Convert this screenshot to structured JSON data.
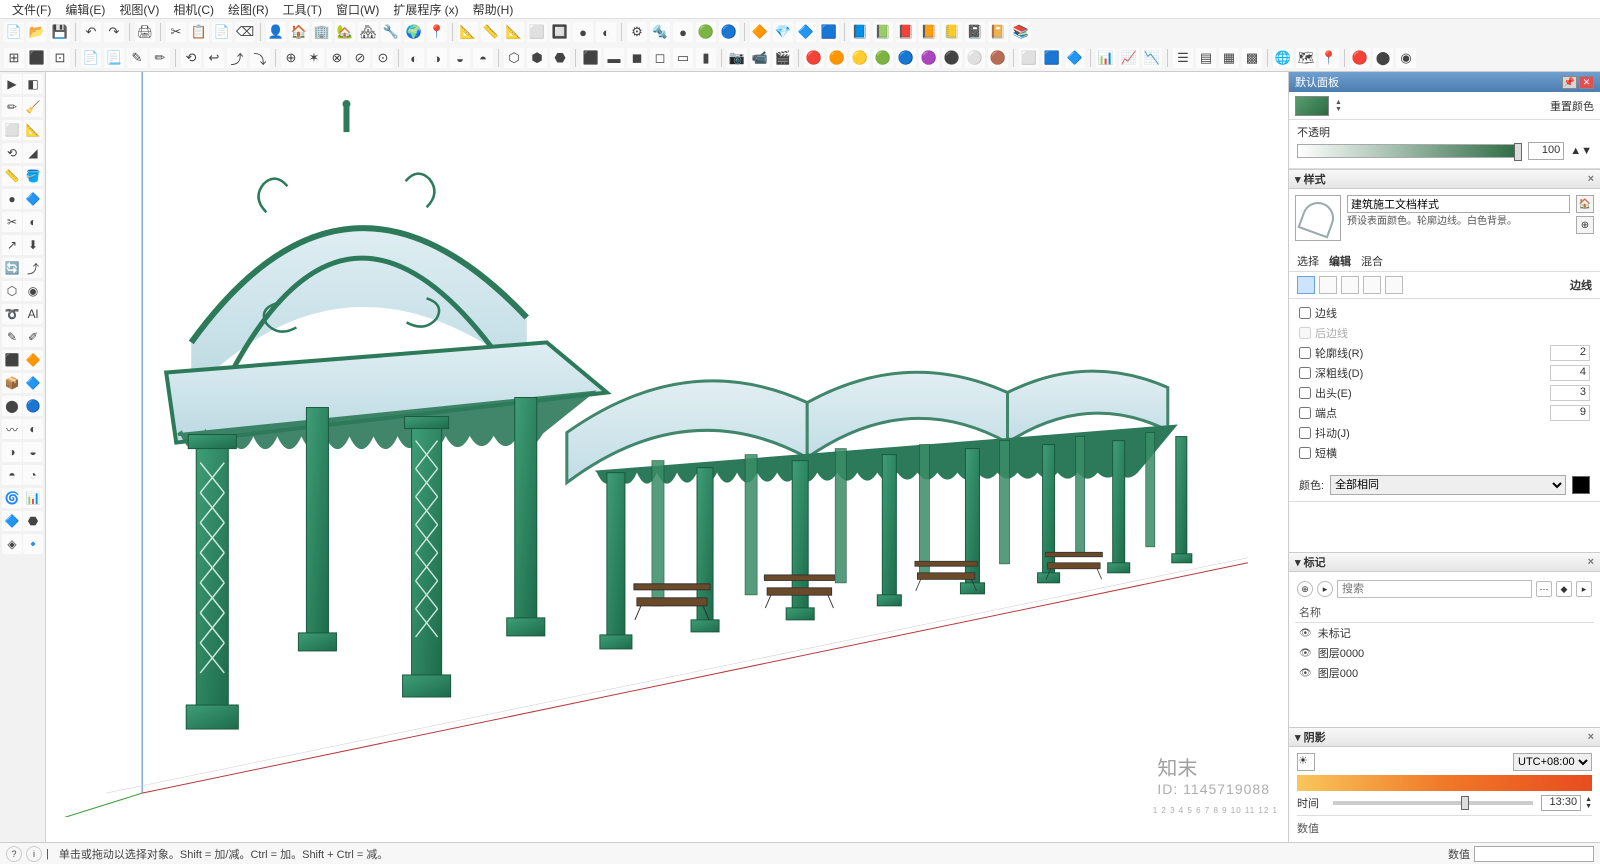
{
  "menu": {
    "items": [
      "文件(F)",
      "编辑(E)",
      "视图(V)",
      "相机(C)",
      "绘图(R)",
      "工具(T)",
      "窗口(W)",
      "扩展程序 (x)",
      "帮助(H)"
    ]
  },
  "toolbarRow1": [
    "📄",
    "📂",
    "💾",
    "|",
    "↶",
    "↷",
    "|",
    "🖨",
    "|",
    "✂",
    "📋",
    "📄",
    "⌫",
    "|",
    "👤",
    "🏠",
    "🏢",
    "🏡",
    "🏘",
    "🔧",
    "🌍",
    "📍",
    "|",
    "📐",
    "📏",
    "📐",
    "⬜",
    "🔲",
    "●",
    "◐",
    "|",
    "⚙",
    "🔩",
    "●",
    "🟢",
    "🔵",
    "|",
    "🔶",
    "💎",
    "🔷",
    "🟦",
    "|",
    "📘",
    "📗",
    "📕",
    "📙",
    "📒",
    "📓",
    "📔",
    "📚"
  ],
  "toolbarRow2": [
    "⊞",
    "⬛",
    "⊡",
    "|",
    "📄",
    "📃",
    "✎",
    "✏",
    "|",
    "⟲",
    "↩",
    "⤴",
    "⤵",
    "|",
    "⊕",
    "✶",
    "⊗",
    "⊘",
    "⊙",
    "|",
    "◐",
    "◑",
    "◒",
    "◓",
    "|",
    "⬡",
    "⬢",
    "⬣",
    "|",
    "⬛",
    "▬",
    "◼",
    "◻",
    "▭",
    "▮",
    "|",
    "📷",
    "📹",
    "🎬",
    "|",
    "🔴",
    "🟠",
    "🟡",
    "🟢",
    "🔵",
    "🟣",
    "⚫",
    "⚪",
    "🟤",
    "|",
    "⬜",
    "🟦",
    "🔷",
    "|",
    "📊",
    "📈",
    "📉",
    "|",
    "☰",
    "▤",
    "▦",
    "▩",
    "|",
    "🌐",
    "🗺",
    "📍",
    "|",
    "🔴",
    "⬤",
    "◉"
  ],
  "toolbox": [
    "▶",
    "◧",
    "✏",
    "🧹",
    "⬜",
    "📐",
    "⟲",
    "◢",
    "📏",
    "🪣",
    "●",
    "🔷",
    "✂",
    "◐",
    "↗",
    "⬇",
    "🔄",
    "⤴",
    "⬡",
    "◉",
    "➰",
    "Al",
    "✎",
    "✐",
    "⬛",
    "🔶",
    "📦",
    "🔷",
    "⬤",
    "🔵",
    "〰",
    "◐",
    "◑",
    "◒",
    "◓",
    "◔",
    "🌀",
    "📊",
    "🔷",
    "⬣",
    "◈",
    "🔹"
  ],
  "tray": {
    "title": "默认面板",
    "reset_color": "重置颜色",
    "opacity": {
      "label": "不透明",
      "value": "100"
    },
    "styles": {
      "head": "▾ 样式",
      "name": "建筑施工文档样式",
      "desc": "预设表面颜色。轮廓边线。白色背景。"
    },
    "tabs": {
      "select": "选择",
      "edit": "编辑",
      "mix": "混合"
    },
    "edges_label": "边线",
    "edge_opts": {
      "edges": "边线",
      "back": "后边线",
      "profile": "轮廓线(R)",
      "profile_v": "2",
      "depth": "深粗线(D)",
      "depth_v": "4",
      "ext": "出头(E)",
      "ext_v": "3",
      "end": "端点",
      "end_v": "9",
      "jitter": "抖动(J)",
      "dash": "短横"
    },
    "color": {
      "label": "颜色:",
      "option": "全部相同"
    },
    "tags": {
      "head": "▾ 标记",
      "search_placeholder": "搜索",
      "col_name": "名称",
      "items": [
        "未标记",
        "图层0000",
        "图层000"
      ]
    },
    "shadows": {
      "head": "▾ 阴影",
      "utc": "UTC+08:00",
      "time_label": "时间",
      "time_val": "13:30",
      "values_label": "数值"
    }
  },
  "status": {
    "hint": "单击或拖动以选择对象。Shift = 加/减。Ctrl = 加。Shift + Ctrl = 减。",
    "ruler": "1 2 3 4 5 6 7 8 9 10 11 12  1",
    "meas_label": "数值"
  },
  "watermark": {
    "brand": "知末",
    "id": "ID: 1145719088"
  }
}
